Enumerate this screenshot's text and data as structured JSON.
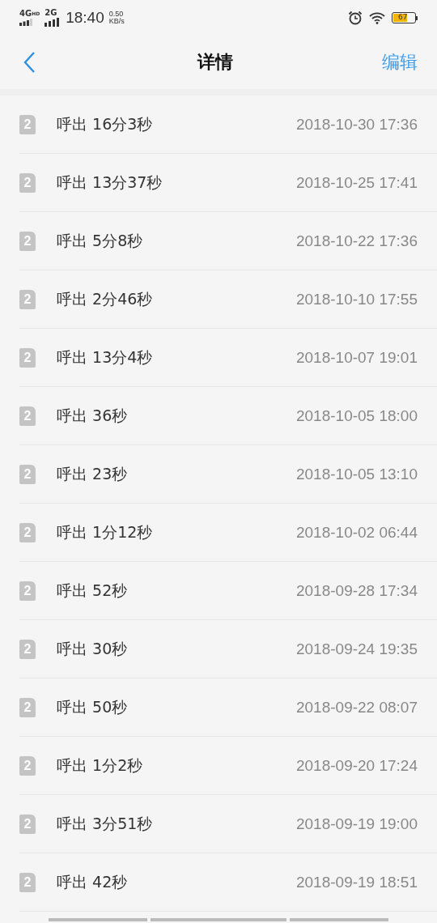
{
  "status_bar": {
    "network_1": "4G",
    "network_1_badge": "HD",
    "network_2": "2G",
    "time": "18:40",
    "speed_value": "0.50",
    "speed_unit": "KB/s",
    "battery": "67"
  },
  "nav": {
    "title": "详情",
    "action": "编辑"
  },
  "calls": [
    {
      "sim": "2",
      "label": "呼出 16分3秒",
      "time": "2018-10-30 17:36"
    },
    {
      "sim": "2",
      "label": "呼出 13分37秒",
      "time": "2018-10-25 17:41"
    },
    {
      "sim": "2",
      "label": "呼出 5分8秒",
      "time": "2018-10-22 17:36"
    },
    {
      "sim": "2",
      "label": "呼出 2分46秒",
      "time": "2018-10-10 17:55"
    },
    {
      "sim": "2",
      "label": "呼出 13分4秒",
      "time": "2018-10-07 19:01"
    },
    {
      "sim": "2",
      "label": "呼出 36秒",
      "time": "2018-10-05 18:00"
    },
    {
      "sim": "2",
      "label": "呼出 23秒",
      "time": "2018-10-05 13:10"
    },
    {
      "sim": "2",
      "label": "呼出 1分12秒",
      "time": "2018-10-02 06:44"
    },
    {
      "sim": "2",
      "label": "呼出 52秒",
      "time": "2018-09-28 17:34"
    },
    {
      "sim": "2",
      "label": "呼出 30秒",
      "time": "2018-09-24 19:35"
    },
    {
      "sim": "2",
      "label": "呼出 50秒",
      "time": "2018-09-22 08:07"
    },
    {
      "sim": "2",
      "label": "呼出 1分2秒",
      "time": "2018-09-20 17:24"
    },
    {
      "sim": "2",
      "label": "呼出 3分51秒",
      "time": "2018-09-19 19:00"
    },
    {
      "sim": "2",
      "label": "呼出 42秒",
      "time": "2018-09-19 18:51"
    }
  ]
}
